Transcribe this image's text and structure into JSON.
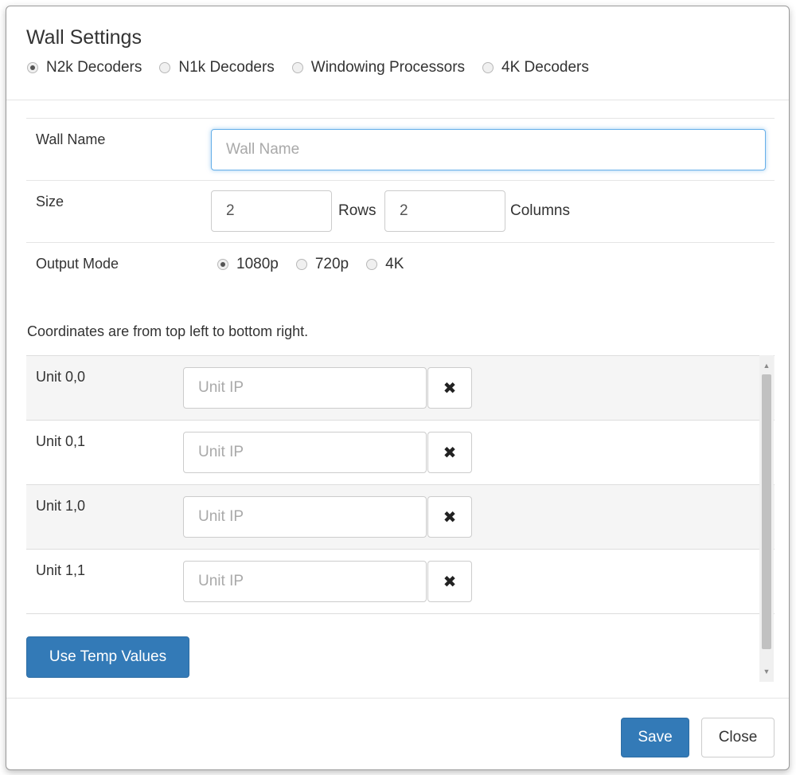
{
  "header": {
    "title": "Wall Settings",
    "decoder_types": [
      {
        "label": "N2k Decoders",
        "checked": true
      },
      {
        "label": "N1k Decoders",
        "checked": false
      },
      {
        "label": "Windowing Processors",
        "checked": false
      },
      {
        "label": "4K Decoders",
        "checked": false
      }
    ]
  },
  "form": {
    "wall_name": {
      "label": "Wall Name",
      "value": "",
      "placeholder": "Wall Name"
    },
    "size": {
      "label": "Size",
      "rows_value": "2",
      "rows_label": "Rows",
      "columns_value": "2",
      "columns_label": "Columns"
    },
    "output_mode": {
      "label": "Output Mode",
      "options": [
        {
          "label": "1080p",
          "checked": true
        },
        {
          "label": "720p",
          "checked": false
        },
        {
          "label": "4K",
          "checked": false
        }
      ]
    }
  },
  "coordinates_note": "Coordinates are from top left to bottom right.",
  "units": [
    {
      "label": "Unit 0,0",
      "placeholder": "Unit IP",
      "remove_glyph": "✖"
    },
    {
      "label": "Unit 0,1",
      "placeholder": "Unit IP",
      "remove_glyph": "✖"
    },
    {
      "label": "Unit 1,0",
      "placeholder": "Unit IP",
      "remove_glyph": "✖"
    },
    {
      "label": "Unit 1,1",
      "placeholder": "Unit IP",
      "remove_glyph": "✖"
    }
  ],
  "temp_button": {
    "label": "Use Temp Values"
  },
  "footer": {
    "save_label": "Save",
    "close_label": "Close"
  },
  "icons": {
    "remove": "close-icon",
    "scroll_up": "caret-up-icon",
    "scroll_down": "caret-down-icon"
  },
  "colors": {
    "primary": "#337ab7",
    "focus": "#66afe9"
  }
}
